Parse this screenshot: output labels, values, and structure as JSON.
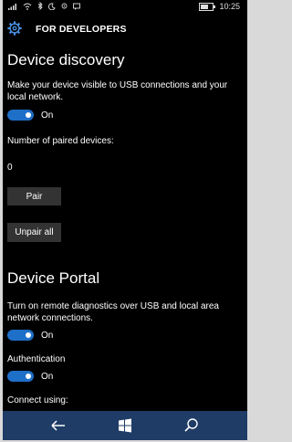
{
  "status": {
    "time": "10:25"
  },
  "header": {
    "icon": "gear-icon",
    "title": "FOR DEVELOPERS"
  },
  "discovery": {
    "title": "Device discovery",
    "description": "Make your device visible to USB connections and your local network.",
    "toggle_state": "On",
    "paired_label": "Number of paired devices:",
    "paired_count": "0",
    "pair_button": "Pair",
    "unpair_button": "Unpair all"
  },
  "portal": {
    "title": "Device Portal",
    "description": "Turn on remote diagnostics over USB and local area network connections.",
    "toggle_state": "On",
    "auth_label": "Authentication",
    "auth_state": "On",
    "connect_label": "Connect using:"
  },
  "nav": {
    "back": "back-arrow-icon",
    "start": "windows-logo-icon",
    "search": "search-icon"
  },
  "colors": {
    "accent": "#1e6fc7",
    "navbar": "#1f3c66",
    "button": "#333333"
  }
}
